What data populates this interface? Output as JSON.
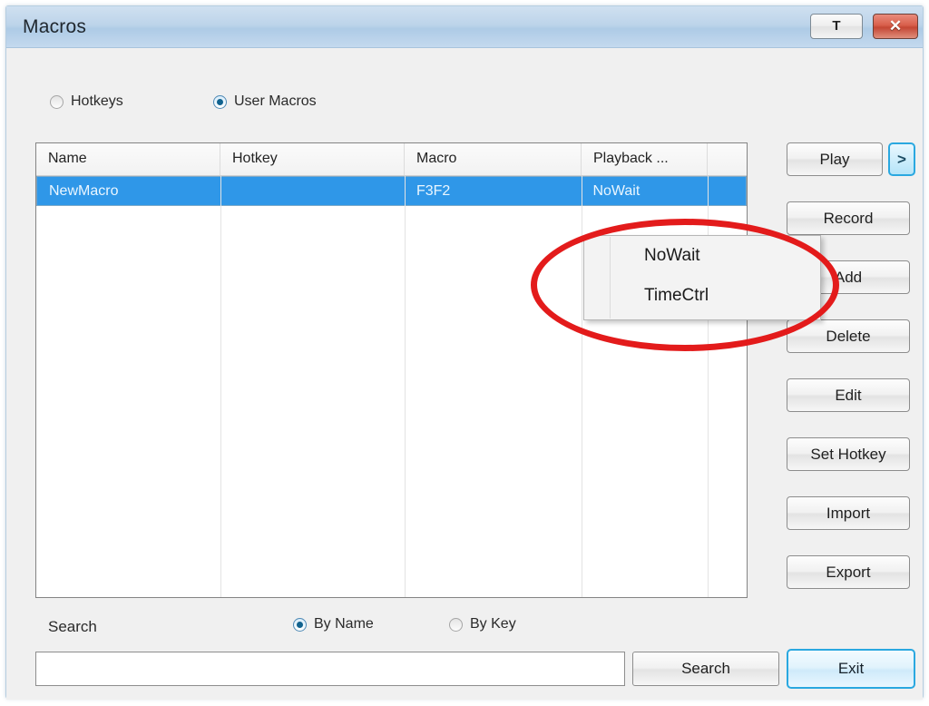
{
  "window": {
    "title": "Macros",
    "titlebar_buttons": [
      {
        "name": "text-mode-button",
        "label": "T"
      },
      {
        "name": "close-button",
        "label": "✕"
      }
    ]
  },
  "mode_radios": {
    "options": [
      {
        "label": "Hotkeys",
        "checked": false
      },
      {
        "label": "User Macros",
        "checked": true
      }
    ]
  },
  "list": {
    "columns": [
      "Name",
      "Hotkey",
      "Macro",
      "Playback ...",
      ""
    ],
    "rows": [
      {
        "name": "NewMacro",
        "hotkey": "",
        "macro": "F3F2",
        "playback": "NoWait",
        "selected": true
      }
    ]
  },
  "dropdown": {
    "items": [
      {
        "label": "NoWait"
      },
      {
        "label": "TimeCtrl"
      }
    ]
  },
  "side_buttons": [
    {
      "name": "play-button",
      "label": "Play"
    },
    {
      "name": "play-options-button",
      "label": ">"
    },
    {
      "name": "record-button",
      "label": "Record"
    },
    {
      "name": "add-button",
      "label": "Add"
    },
    {
      "name": "delete-button",
      "label": "Delete"
    },
    {
      "name": "edit-button",
      "label": "Edit"
    },
    {
      "name": "set-hotkey-button",
      "label": "Set Hotkey"
    },
    {
      "name": "import-button",
      "label": "Import"
    },
    {
      "name": "export-button",
      "label": "Export"
    }
  ],
  "search": {
    "label": "Search",
    "value": "",
    "placeholder": "",
    "radios": [
      {
        "label": "By Name",
        "checked": true
      },
      {
        "label": "By Key",
        "checked": false
      }
    ],
    "search_button": "Search",
    "exit_button": "Exit"
  },
  "colors": {
    "selection_blue": "#2f97e8",
    "accent_blue": "#2aa8e0",
    "annotation_red": "#e31b1b",
    "close_red": "#c44734",
    "titlebar_blue": "#bdd4ea"
  }
}
